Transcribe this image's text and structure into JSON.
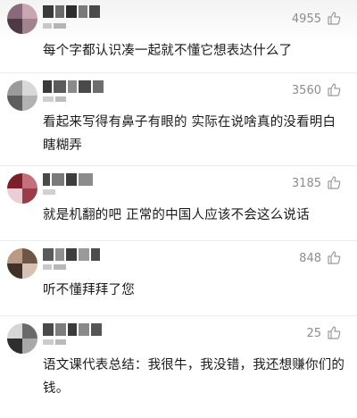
{
  "comments": [
    {
      "likes": "4955",
      "text": "每个字都认识凑一起就不懂它想表达什么了"
    },
    {
      "likes": "3560",
      "text": "看起来写得有鼻子有眼的 实际在说啥真的没看明白 瞎糊弄"
    },
    {
      "likes": "3185",
      "text": "就是机翻的吧 正常的中国人应该不会这么说话"
    },
    {
      "likes": "848",
      "text": "听不懂拜拜了您"
    },
    {
      "likes": "25",
      "text": "语文课代表总结：我很牛，我没错，我还想赚你们的钱。"
    }
  ],
  "icons": {
    "like": "thumbs-up-icon"
  },
  "colors": {
    "text": "#1a1a1a",
    "muted": "#8c8c8c",
    "divider": "#ececec"
  }
}
